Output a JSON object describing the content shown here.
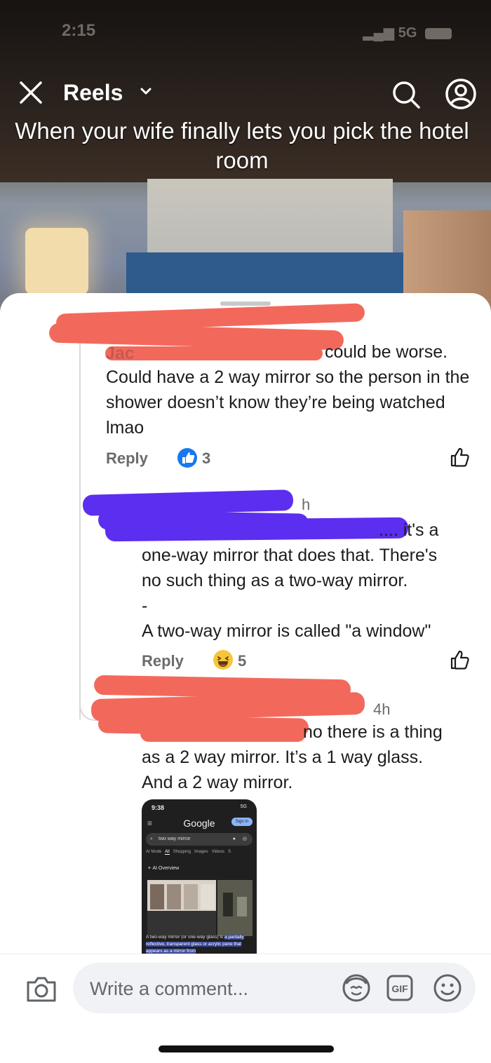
{
  "status_bar": {
    "time": "2:15",
    "signal": "5G"
  },
  "top_bar": {
    "title": "Reels"
  },
  "video": {
    "caption": "When your wife finally lets you pick the hotel room"
  },
  "comments": [
    {
      "author_fragment": "Jac",
      "text_visible": "could be worse. Could have a 2 way mirror so the person in the shower doesn’t know they’re being watched lmao",
      "reply_label": "Reply",
      "reaction": "like",
      "reaction_count": "3"
    },
    {
      "time": "h",
      "text_lead": ".... it's a",
      "text_line2": "one-way mirror that does that. There's",
      "text_line3": "no such thing as a two-way mirror.",
      "text_line4": "-",
      "text_line5": "A two-way mirror is called \"a window\"",
      "reply_label": "Reply",
      "reaction": "haha",
      "reaction_count": "5"
    },
    {
      "time": "4h",
      "text_lead": "no there is a thing",
      "text_line2": "as a 2 way mirror. It’s a 1 way glass.",
      "text_line3": "And a 2 way mirror.",
      "attachment": {
        "time": "9:38",
        "status": "5G",
        "brand": "Google",
        "sign_in": "Sign in",
        "query": "two way mirror",
        "tabs": [
          "AI Mode",
          "All",
          "Shopping",
          "Images",
          "Videos",
          "S"
        ],
        "active_tab": "All",
        "section": "AI Overview",
        "desc_plain": "A two-way mirror (or one-way glass) is ",
        "desc_highlight": "a partially reflective, transparent glass or acrylic pane that appears as a mirror from"
      }
    }
  ],
  "composer": {
    "placeholder": "Write a comment...",
    "gif_label": "GIF"
  },
  "colors": {
    "like_blue": "#1877f2",
    "redaction_red": "#f2695c",
    "redaction_purple": "#5b2ef0"
  }
}
